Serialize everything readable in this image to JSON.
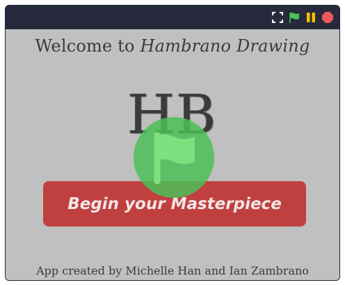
{
  "window": {
    "controls": [
      {
        "name": "fullscreen-icon",
        "color": "#ffffff"
      },
      {
        "name": "green-flag-icon",
        "color": "#4cbf56"
      },
      {
        "name": "pause-icon",
        "color": "#ffbf00"
      },
      {
        "name": "stop-icon",
        "color": "#ec5959"
      }
    ]
  },
  "stage": {
    "welcome_prefix": "Welcome to ",
    "welcome_app_name": "Hambrano Drawing",
    "logo_text": "HB",
    "begin_button_label": "Begin your Masterpiece",
    "credits": "App created by Michelle Han and Ian Zambrano",
    "colors": {
      "background": "#c0c0c0",
      "button": "#c04040",
      "overlay_green": "#4cbf56",
      "titlebar": "#262a3c"
    }
  }
}
